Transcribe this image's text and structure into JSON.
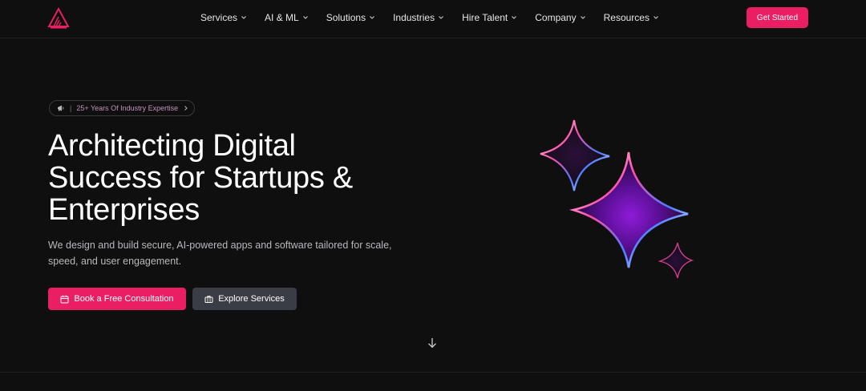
{
  "nav": {
    "items": [
      {
        "label": "Services"
      },
      {
        "label": "AI & ML"
      },
      {
        "label": "Solutions"
      },
      {
        "label": "Industries"
      },
      {
        "label": "Hire Talent"
      },
      {
        "label": "Company"
      },
      {
        "label": "Resources"
      }
    ],
    "cta_label": "Get Started"
  },
  "hero": {
    "badge_sep": "|",
    "badge_text": "25+ Years Of Industry Expertise",
    "title_line1": "Architecting Digital",
    "title_line2": "Success for Startups &",
    "title_line3": "Enterprises",
    "subtitle": "We design and build secure, AI-powered apps and software tailored for scale, speed, and user engagement.",
    "primary_cta": "Book a Free Consultation",
    "secondary_cta": "Explore Services"
  },
  "icons": {
    "logo": "logo-icon",
    "nav_dropdown": "chevron-down-icon",
    "badge": "megaphone-icon",
    "badge_arrow": "chevron-right-icon",
    "calendar": "calendar-icon",
    "briefcase": "briefcase-icon",
    "scroll": "arrow-down-icon",
    "hero_art": "sparkle-stars-icon"
  },
  "colors": {
    "background": "#0f0f10",
    "accent": "#e91e63",
    "secondary_button": "#3a3d46"
  }
}
